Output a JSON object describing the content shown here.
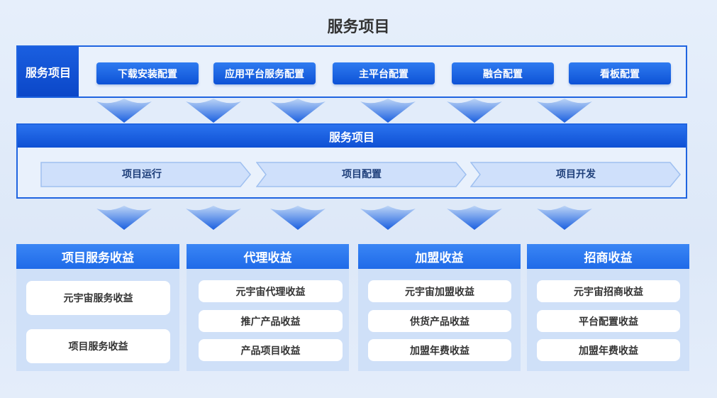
{
  "title": "服务项目",
  "top": {
    "side_label": "服务项目",
    "buttons": [
      "下载安装配置",
      "应用平台服务配置",
      "主平台配置",
      "融合配置",
      "看板配置"
    ]
  },
  "middle": {
    "header": "服务项目",
    "steps": [
      "项目运行",
      "项目配置",
      "项目开发"
    ]
  },
  "columns": [
    {
      "title": "项目服务收益",
      "items": [
        "元宇宙服务收益",
        "项目服务收益"
      ]
    },
    {
      "title": "代理收益",
      "items": [
        "元宇宙代理收益",
        "推广产品收益",
        "产品项目收益"
      ]
    },
    {
      "title": "加盟收益",
      "items": [
        "元宇宙加盟收益",
        "供货产品收益",
        "加盟年费收益"
      ]
    },
    {
      "title": "招商收益",
      "items": [
        "元宇宙招商收益",
        "平台配置收益",
        "加盟年费收益"
      ]
    }
  ],
  "colors": {
    "primary": "#1f64e0",
    "column_bg": "#cfe0f8",
    "chevron_fill": "#cfe0fb"
  }
}
